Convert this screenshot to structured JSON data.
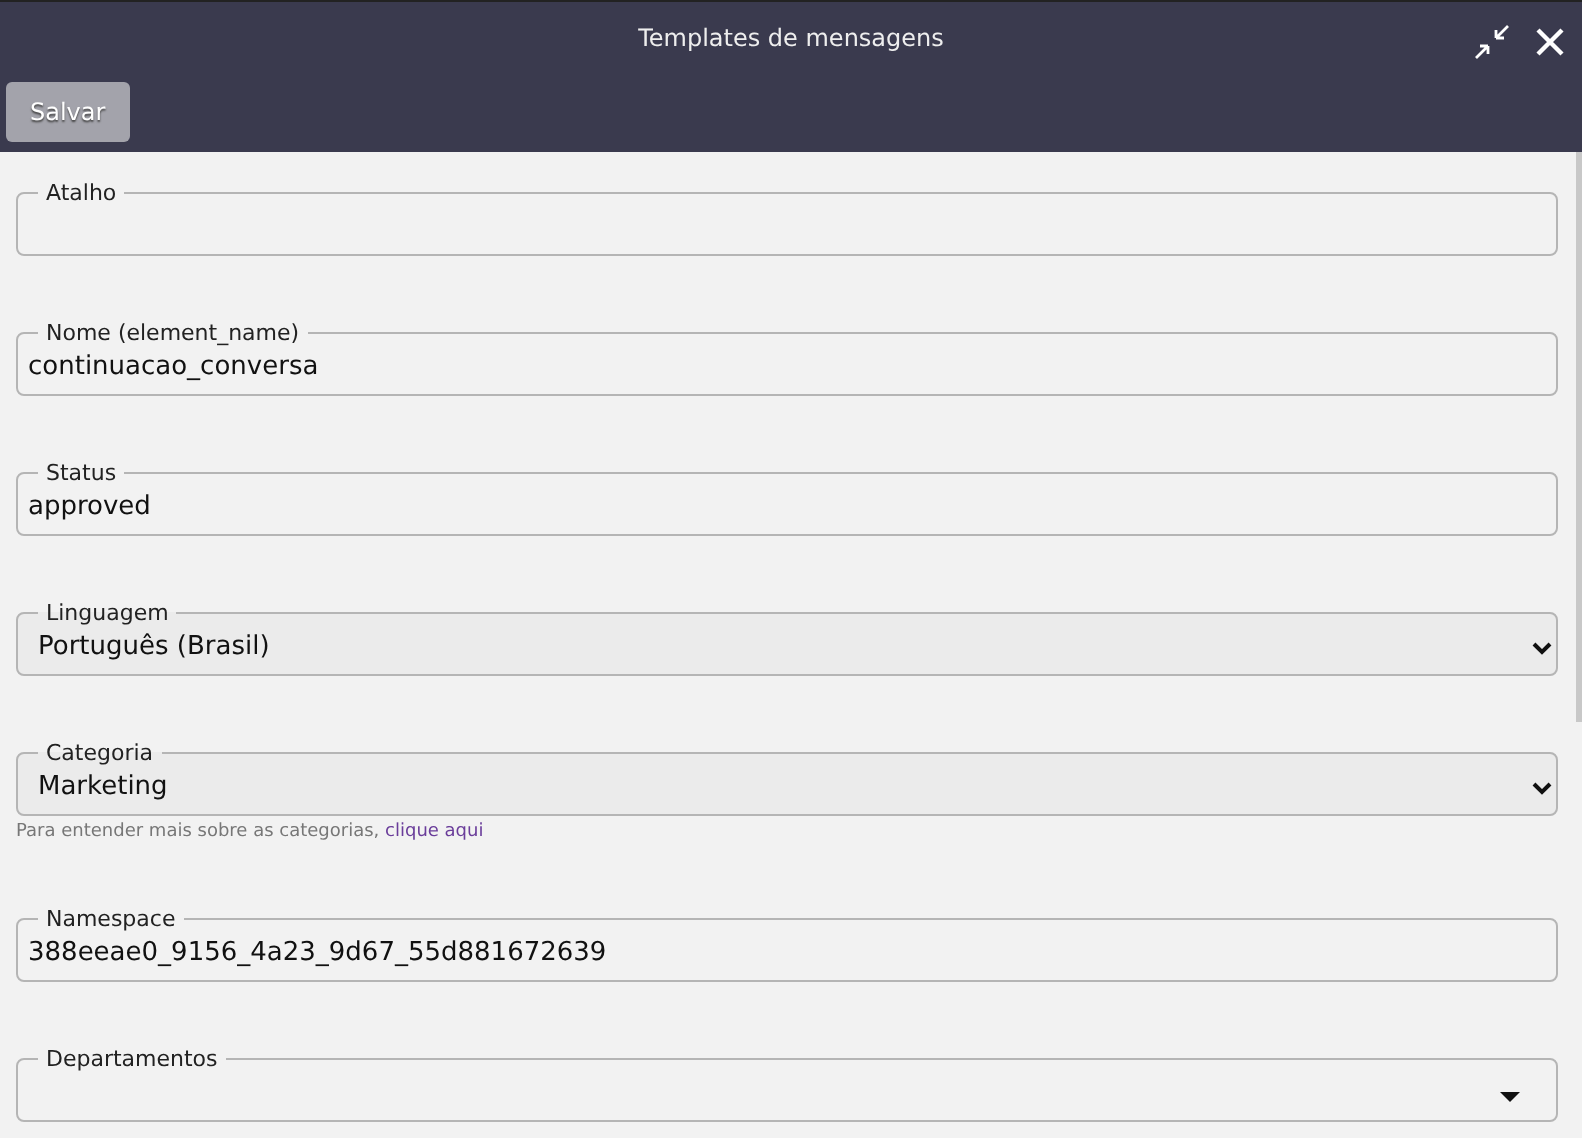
{
  "window": {
    "title": "Templates de mensagens"
  },
  "toolbar": {
    "buttons": [
      "Salvar"
    ]
  },
  "fields": [
    {
      "kind": "text",
      "label": "Atalho"
    },
    {
      "kind": "text",
      "label": "Nome (element_name)",
      "value": "continuacao_conversa"
    },
    {
      "kind": "text",
      "label": "Status",
      "value": "approved"
    },
    {
      "kind": "select",
      "label": "Linguagem",
      "value": "Português (Brasil)"
    },
    {
      "kind": "select",
      "label": "Categoria",
      "value": "Marketing",
      "help": {
        "text": "Para entender mais sobre as categorias, ",
        "link": "clique aqui"
      }
    },
    {
      "kind": "text",
      "label": "Namespace",
      "value": "388eeae0_9156_4a23_9d67_55d881672639"
    },
    {
      "kind": "multiselect",
      "label": "Departamentos"
    }
  ]
}
